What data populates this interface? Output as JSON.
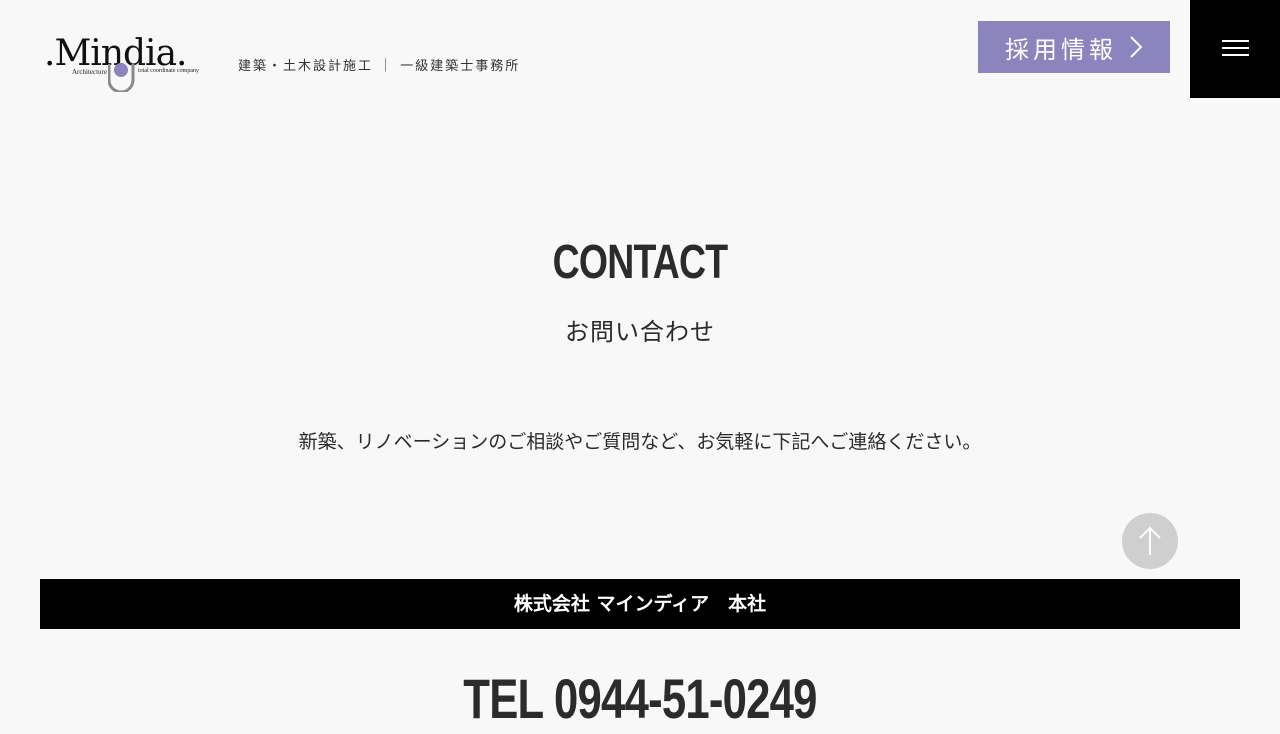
{
  "header": {
    "logo": {
      "wordmark": ".Mindia.",
      "sub_left": "Architecture",
      "sub_right": "total coordinate company"
    },
    "tagline": "建築・土木設計施工 ｜ 一級建築士事務所",
    "recruit_label": "採用情報",
    "recruit_icon": "chevron-right-icon",
    "menu_icon": "hamburger-menu-icon"
  },
  "contact": {
    "title": "CONTACT",
    "subtitle": "お問い合わせ",
    "lead": "新築、リノベーションのご相談やご質問など、お気軽に下記へご連絡ください。"
  },
  "company": {
    "name": "株式会社 マインディア　本社",
    "tel": "TEL 0944-51-0249"
  },
  "scroll_top_icon": "arrow-up-icon",
  "colors": {
    "background": "#f8f8f8",
    "accent_purple": "#8c84bd",
    "text": "#2b2b2b",
    "black": "#000000",
    "to_top_circle": "#cfcfcf"
  }
}
